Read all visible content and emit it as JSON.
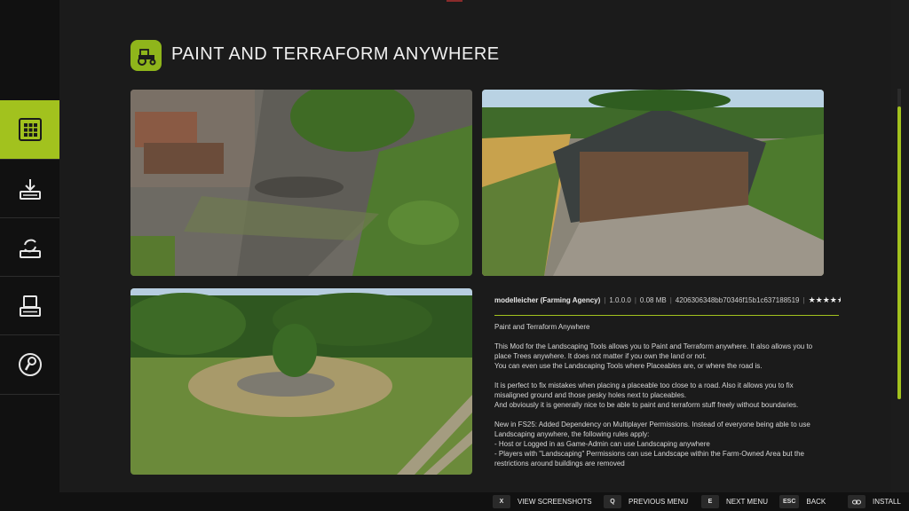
{
  "header": {
    "title": "PAINT AND TERRAFORM ANYWHERE",
    "icon": "tractor-icon"
  },
  "sidebar": {
    "items": [
      {
        "icon": "grid-icon",
        "active": true
      },
      {
        "icon": "download-icon",
        "active": false
      },
      {
        "icon": "update-icon",
        "active": false
      },
      {
        "icon": "mod-list-icon",
        "active": false
      },
      {
        "icon": "wrench-icon",
        "active": false
      }
    ]
  },
  "mod": {
    "author": "modelleicher (Farming Agency)",
    "version": "1.0.0.0",
    "size": "0.08 MB",
    "hash": "4206306348bb70346f15b1c637188519",
    "rating": "★★★★★",
    "description": [
      "Paint and Terraform Anywhere",
      "",
      "This Mod for the Landscaping Tools allows you to Paint and Terraform anywhere. It also allows you to place Trees anywhere. It does not matter if you own the land or not.",
      "You can even use the Landscaping Tools where Placeables are, or where the road is.",
      "",
      "It is perfect to fix mistakes when placing a placeable too close to a road. Also it allows you to fix misaligned ground and those pesky holes next to placeables.",
      "And obviously it is generally nice to be able to paint and terraform stuff freely without boundaries.",
      "",
      "New in FS25: Added Dependency on Multiplayer Permissions. Instead of everyone being able to use Landscaping anywhere, the following rules apply:",
      "- Host or Logged in as Game-Admin can use Landscaping anywhere",
      "- Players with \"Landscaping\" Permissions can use Landscape within the Farm-Owned Area but the restrictions around buildings are removed"
    ]
  },
  "footer": {
    "hints": [
      {
        "key": "X",
        "label": "VIEW SCREENSHOTS"
      },
      {
        "key": "Q",
        "label": "PREVIOUS MENU"
      },
      {
        "key": "E",
        "label": "NEXT MENU"
      },
      {
        "key": "ESC",
        "label": "BACK"
      },
      {
        "key": "",
        "label": "INSTALL",
        "icon": "link-icon"
      }
    ]
  },
  "colors": {
    "accent": "#a2c21e"
  }
}
